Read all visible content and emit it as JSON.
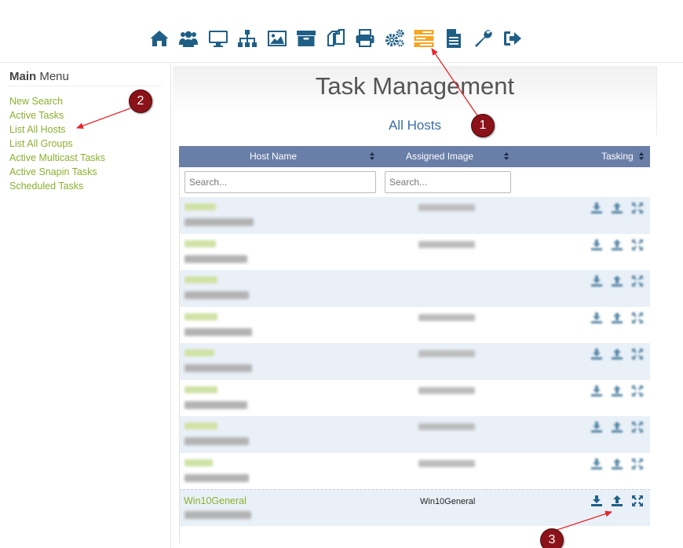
{
  "toolbar": {
    "icons": [
      "home-icon",
      "users-icon",
      "monitor-icon",
      "sitemap-icon",
      "image-icon",
      "archive-icon",
      "copy-icon",
      "printer-icon",
      "cogs-icon",
      "tasks-icon",
      "file-icon",
      "wrench-icon",
      "logout-icon"
    ],
    "active_color": "#f5a623",
    "icon_color": "#1f5f86"
  },
  "sidebar": {
    "title_bold": "Main",
    "title_rest": " Menu",
    "items": [
      {
        "label": "New Search"
      },
      {
        "label": "Active Tasks"
      },
      {
        "label": "List All Hosts"
      },
      {
        "label": "List All Groups"
      },
      {
        "label": "Active Multicast Tasks"
      },
      {
        "label": "Active Snapin Tasks"
      },
      {
        "label": "Scheduled Tasks"
      }
    ]
  },
  "main": {
    "title": "Task Management",
    "subtitle": "All Hosts"
  },
  "table": {
    "columns": {
      "host": "Host Name",
      "image": "Assigned Image",
      "tasking": "Tasking"
    },
    "search_placeholder": "Search...",
    "header_color": "#6a7fa8",
    "visible_host": {
      "name": "Win10General",
      "image": "Win10General"
    }
  },
  "annotations": {
    "one": "1",
    "two": "2",
    "three": "3",
    "color": "#8b1219"
  }
}
